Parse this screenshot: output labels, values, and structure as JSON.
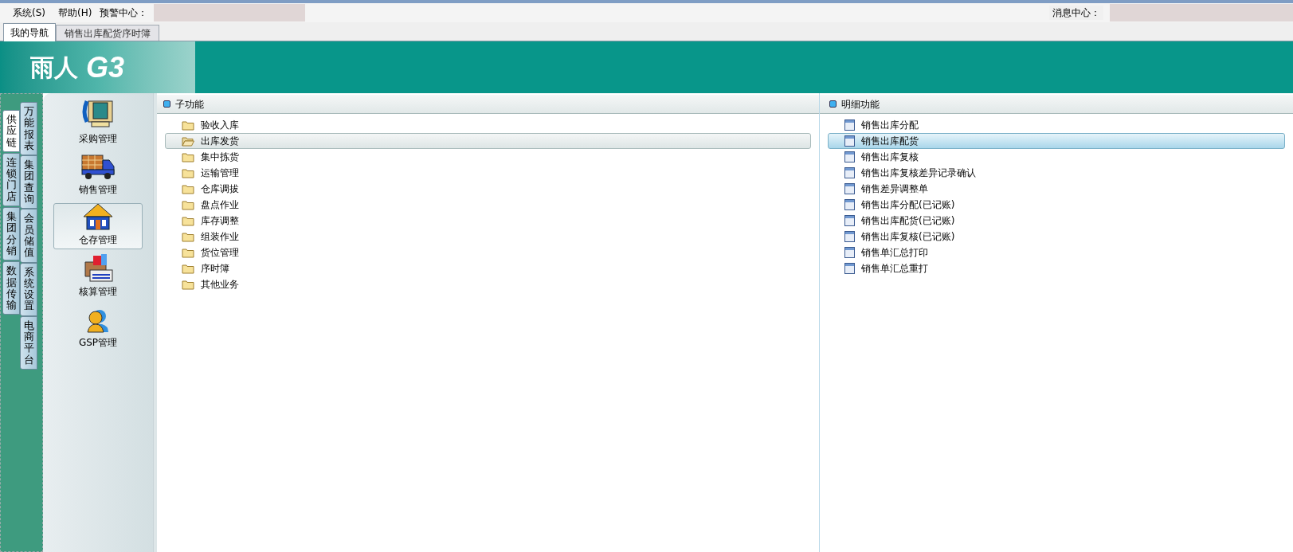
{
  "menu_bar": {
    "items": [
      {
        "label": "系统(S)"
      },
      {
        "label": "帮助(H)"
      }
    ],
    "alert_center": {
      "label": "预警中心："
    },
    "message_center": {
      "label": "消息中心："
    }
  },
  "tabs": [
    {
      "label": "我的导航",
      "selected": true
    },
    {
      "label": "销售出库配货序时簿",
      "selected": false
    }
  ],
  "banner": {
    "logo_text": "雨人",
    "logo_mark": "G3"
  },
  "outer_side_tabs": [
    {
      "label": "供应链",
      "selected": true
    },
    {
      "label": "连锁门店",
      "selected": false
    },
    {
      "label": "集团分销",
      "selected": false
    },
    {
      "label": "数据传输",
      "selected": false
    }
  ],
  "inner_side_tabs": [
    {
      "label": "万能报表",
      "selected": false
    },
    {
      "label": "集团查询",
      "selected": false
    },
    {
      "label": "会员储值",
      "selected": false
    },
    {
      "label": "系统设置",
      "selected": false
    },
    {
      "label": "电商平台",
      "selected": false
    }
  ],
  "modules": [
    {
      "label": "采购管理",
      "kind": "phone",
      "selected": false
    },
    {
      "label": "销售管理",
      "kind": "truck",
      "selected": false
    },
    {
      "label": "仓存管理",
      "kind": "house",
      "selected": true
    },
    {
      "label": "核算管理",
      "kind": "box",
      "selected": false
    },
    {
      "label": "GSP管理",
      "kind": "person",
      "selected": false
    }
  ],
  "sub_functions": {
    "title": "子功能",
    "items": [
      {
        "label": "验收入库",
        "selected": false
      },
      {
        "label": "出库发货",
        "selected": true
      },
      {
        "label": "集中拣货",
        "selected": false
      },
      {
        "label": "运输管理",
        "selected": false
      },
      {
        "label": "仓库调拔",
        "selected": false
      },
      {
        "label": "盘点作业",
        "selected": false
      },
      {
        "label": "库存调整",
        "selected": false
      },
      {
        "label": "组装作业",
        "selected": false
      },
      {
        "label": "货位管理",
        "selected": false
      },
      {
        "label": "序时簿",
        "selected": false
      },
      {
        "label": "其他业务",
        "selected": false
      }
    ]
  },
  "detail_functions": {
    "title": "明细功能",
    "items": [
      {
        "label": "销售出库分配",
        "selected": false
      },
      {
        "label": "销售出库配货",
        "selected": true
      },
      {
        "label": "销售出库复核",
        "selected": false
      },
      {
        "label": "销售出库复核差异记录确认",
        "selected": false
      },
      {
        "label": "销售差异调整单",
        "selected": false
      },
      {
        "label": "销售出库分配(已记账)",
        "selected": false
      },
      {
        "label": "销售出库配货(已记账)",
        "selected": false
      },
      {
        "label": "销售出库复核(已记账)",
        "selected": false
      },
      {
        "label": "销售单汇总打印",
        "selected": false
      },
      {
        "label": "销售单汇总重打",
        "selected": false
      }
    ]
  }
}
